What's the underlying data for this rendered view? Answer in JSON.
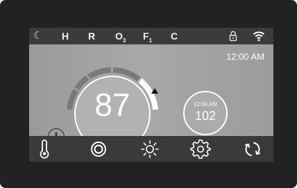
{
  "status_bar": {
    "items": [
      {
        "label": "☾",
        "name": "night-mode"
      },
      {
        "label": "H",
        "name": "heater"
      },
      {
        "label": "R",
        "name": "recirculation"
      },
      {
        "label": "O",
        "sub": "3",
        "name": "ozone"
      },
      {
        "label": "F",
        "sub": "1",
        "name": "filter"
      },
      {
        "label": "C",
        "name": "clean-cycle"
      }
    ],
    "lock_icon": "lock-icon",
    "wifi_icon": "wifi-icon"
  },
  "main": {
    "clock": "12:00 AM",
    "current_temperature": "87",
    "set_panel": {
      "time": "12:00 AM",
      "value": "102"
    },
    "info_label": "i"
  },
  "toolbar": {
    "buttons": [
      {
        "icon": "thermometer-icon"
      },
      {
        "icon": "target-icon"
      },
      {
        "icon": "sun-icon"
      },
      {
        "icon": "gear-icon"
      },
      {
        "icon": "refresh-icon"
      }
    ]
  },
  "colors": {
    "bezel": "#222222",
    "status_bar": "#3b3b3b",
    "toolbar": "#3a3a3a",
    "screen": "#a0a0a0",
    "accent": "#ffffff"
  }
}
